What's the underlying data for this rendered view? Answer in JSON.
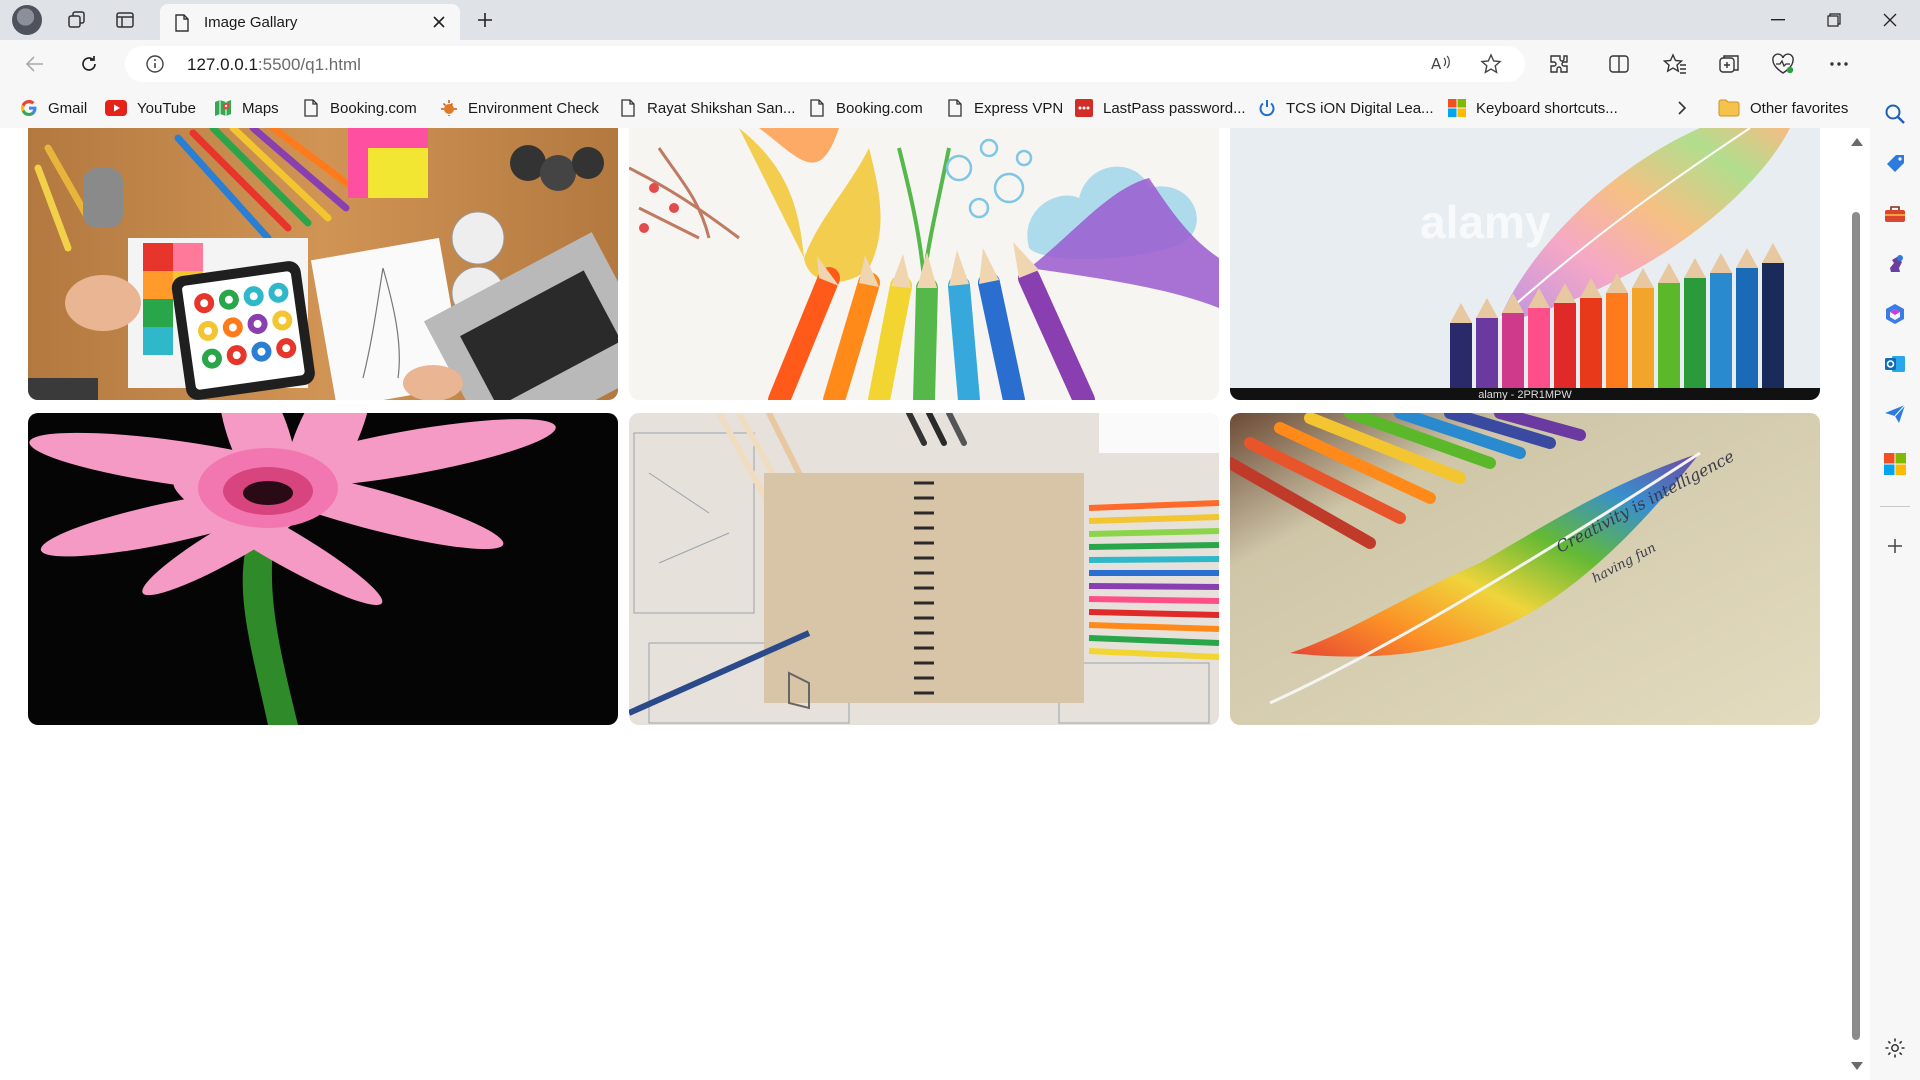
{
  "browser": {
    "tab": {
      "title": "Image Gallary"
    },
    "address": {
      "host": "127.0.0.1",
      "rest": ":5500/q1.html"
    },
    "favorites": [
      {
        "label": "Gmail",
        "icon": "gmail-icon"
      },
      {
        "label": "YouTube",
        "icon": "youtube-icon"
      },
      {
        "label": "Maps",
        "icon": "maps-icon"
      },
      {
        "label": "Booking.com",
        "icon": "page-icon"
      },
      {
        "label": "Environment Check",
        "icon": "environment-icon"
      },
      {
        "label": "Rayat Shikshan San...",
        "icon": "page-icon"
      },
      {
        "label": "Booking.com",
        "icon": "page-icon"
      },
      {
        "label": "Express VPN",
        "icon": "page-icon"
      },
      {
        "label": "LastPass password...",
        "icon": "lastpass-icon"
      },
      {
        "label": "TCS iON Digital Lea...",
        "icon": "power-icon"
      },
      {
        "label": "Keyboard shortcuts...",
        "icon": "microsoft-icon"
      }
    ],
    "other_favorites": "Other favorites"
  },
  "gallery": {
    "images": [
      {
        "name": "designer-desk-image",
        "watermark": ""
      },
      {
        "name": "colored-pencils-elements-image",
        "watermark": ""
      },
      {
        "name": "rainbow-feather-pencils-image",
        "watermark": "alamy - 2PR1MPW"
      },
      {
        "name": "pink-gerbera-image",
        "watermark": ""
      },
      {
        "name": "notebook-sketch-tools-image",
        "watermark": ""
      },
      {
        "name": "rainbow-feather-drawing-image",
        "watermark": ""
      }
    ]
  },
  "colors": {
    "chrome": "#dfe3e8",
    "toolbar": "#f7f7f7",
    "accent": "#0f6cbd"
  }
}
